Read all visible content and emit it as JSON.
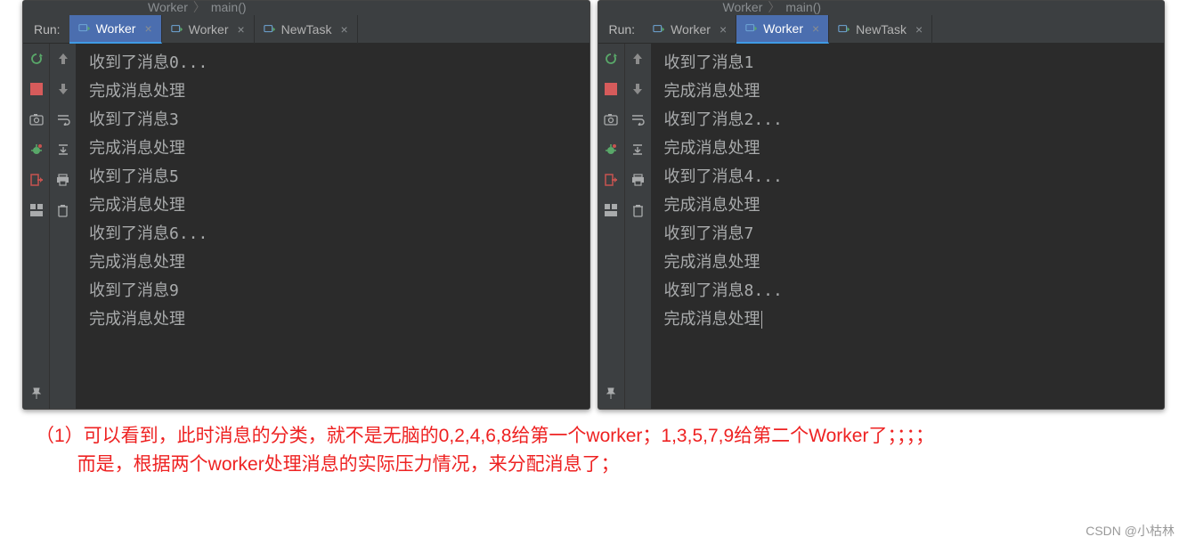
{
  "breadcrumb": {
    "item1": "Worker",
    "item2": "main()"
  },
  "run_label": "Run:",
  "tabs": [
    {
      "label": "Worker",
      "name": "tab-worker-1"
    },
    {
      "label": "Worker",
      "name": "tab-worker-2"
    },
    {
      "label": "NewTask",
      "name": "tab-newtask"
    }
  ],
  "panels": {
    "left": {
      "active_tab_index": 0,
      "lines": [
        "收到了消息0...",
        "完成消息处理",
        "收到了消息3",
        "完成消息处理",
        "收到了消息5",
        "完成消息处理",
        "收到了消息6...",
        "完成消息处理",
        "收到了消息9",
        "完成消息处理"
      ]
    },
    "right": {
      "active_tab_index": 1,
      "lines": [
        "收到了消息1",
        "完成消息处理",
        "收到了消息2...",
        "完成消息处理",
        "收到了消息4...",
        "完成消息处理",
        "收到了消息7",
        "完成消息处理",
        "收到了消息8...",
        "完成消息处理"
      ]
    }
  },
  "commentary": {
    "line1": "（1）可以看到，此时消息的分类，就不是无脑的0,2,4,6,8给第一个worker；1,3,5,7,9给第二个Worker了；；；；",
    "line2": "        而是，根据两个worker处理消息的实际压力情况，来分配消息了；"
  },
  "footer": "CSDN @小枯林",
  "icons": {
    "rerun": "rerun-icon",
    "stop": "stop-icon",
    "camera": "camera-icon",
    "bug": "debug-icon",
    "step-out": "step-out-icon",
    "layout": "layout-icon",
    "pin": "pin-icon",
    "arrow-up": "arrow-up-icon",
    "arrow-down": "arrow-down-icon",
    "soft-wrap": "soft-wrap-icon",
    "scroll-end": "scroll-end-icon",
    "print": "print-icon",
    "trash": "trash-icon"
  }
}
